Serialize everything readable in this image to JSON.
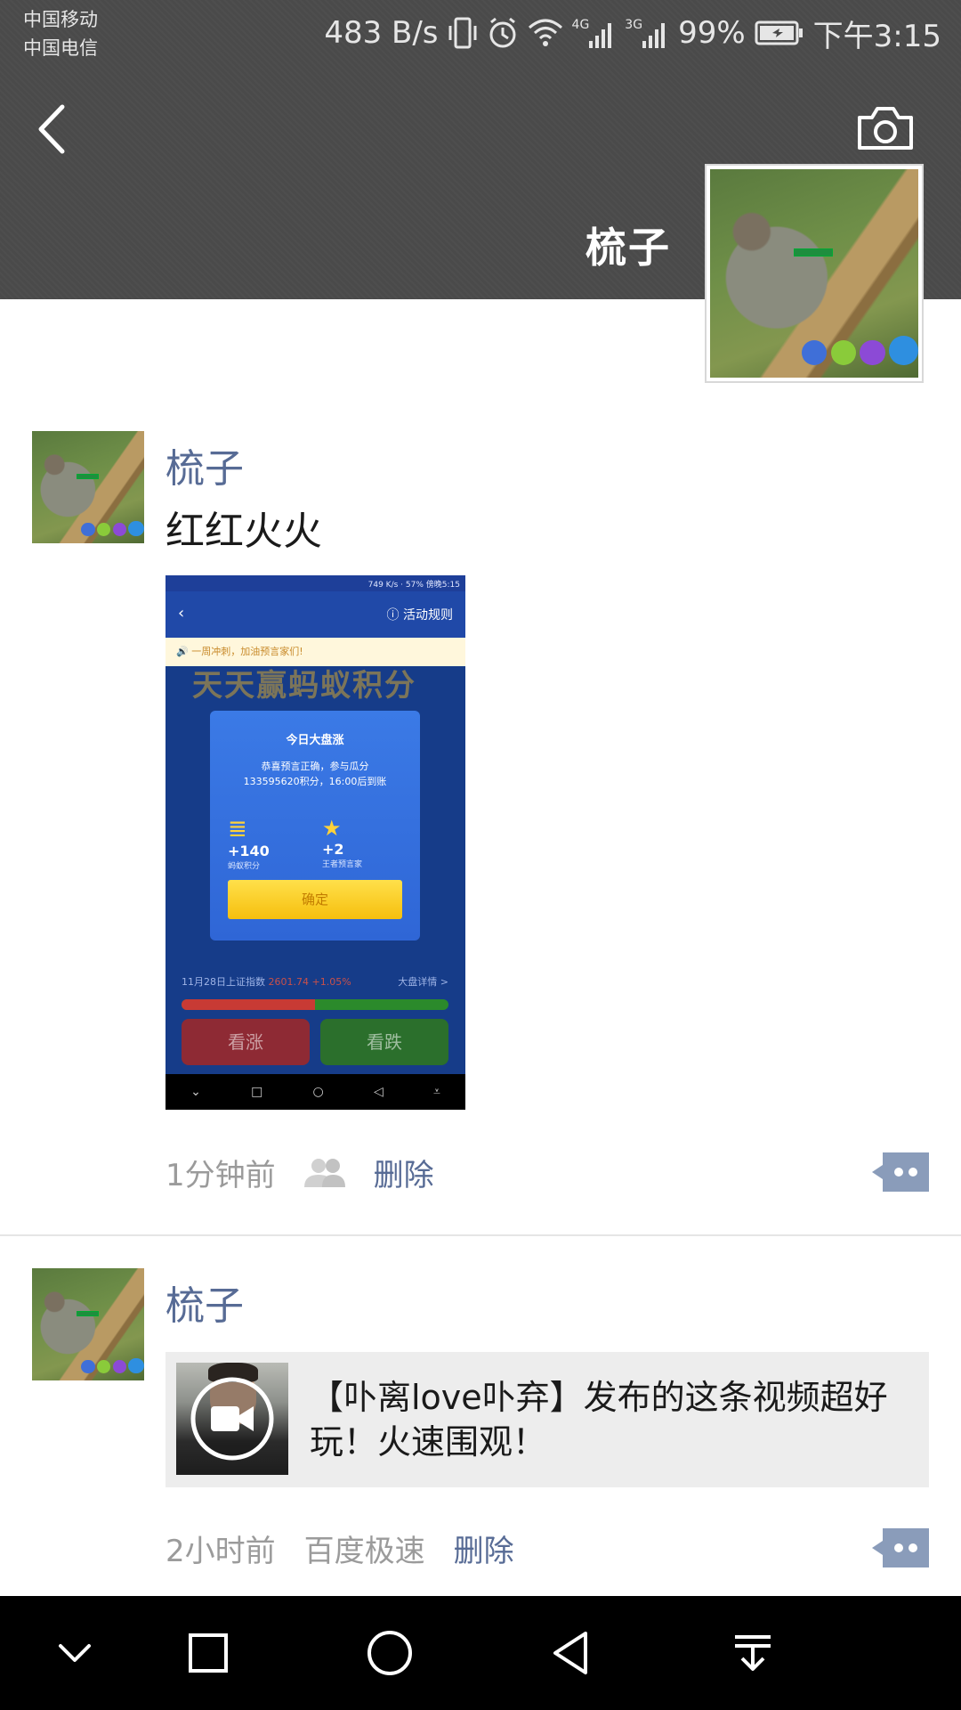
{
  "status_bar": {
    "carrier1": "中国移动",
    "carrier2": "中国电信",
    "speed": "483 B/s",
    "net1": "4G",
    "net2": "3G",
    "battery": "99%",
    "time": "下午3:15"
  },
  "profile": {
    "name": "梳子"
  },
  "posts": [
    {
      "author": "梳子",
      "text": "红红火火",
      "time": "1分钟前",
      "delete_label": "删除",
      "embedded_screenshot": {
        "status_speed": "749 K/s",
        "status_battery": "57%",
        "status_time": "傍晚5:15",
        "back": "‹",
        "rules": "活动规则",
        "notice": "一周冲刺，加油预言家们!",
        "bg_title": "天天赢蚂蚁积分",
        "modal_title": "今日大盘涨",
        "modal_line1": "恭喜预言正确，参与瓜分",
        "modal_line2": "133595620积分，16:00后到账",
        "reward1_value": "+140",
        "reward1_label": "蚂蚁积分",
        "reward2_value": "+2",
        "reward2_label": "王者预言家",
        "confirm": "确定",
        "index_label": "11月28日上证指数",
        "index_value": "2601.74 +1.05%",
        "index_link": "大盘详情 >",
        "up_pct": 0.5,
        "up_button": "看涨",
        "down_button": "看跌"
      }
    },
    {
      "author": "梳子",
      "link_title": "【卟离love卟弃】发布的这条视频超好玩！火速围观！",
      "time": "2小时前",
      "source": "百度极速",
      "delete_label": "删除"
    }
  ],
  "colors": {
    "name_blue": "#576b95",
    "cover_bg": "#4a4a4a",
    "meta_gray": "#9b9b9b"
  }
}
